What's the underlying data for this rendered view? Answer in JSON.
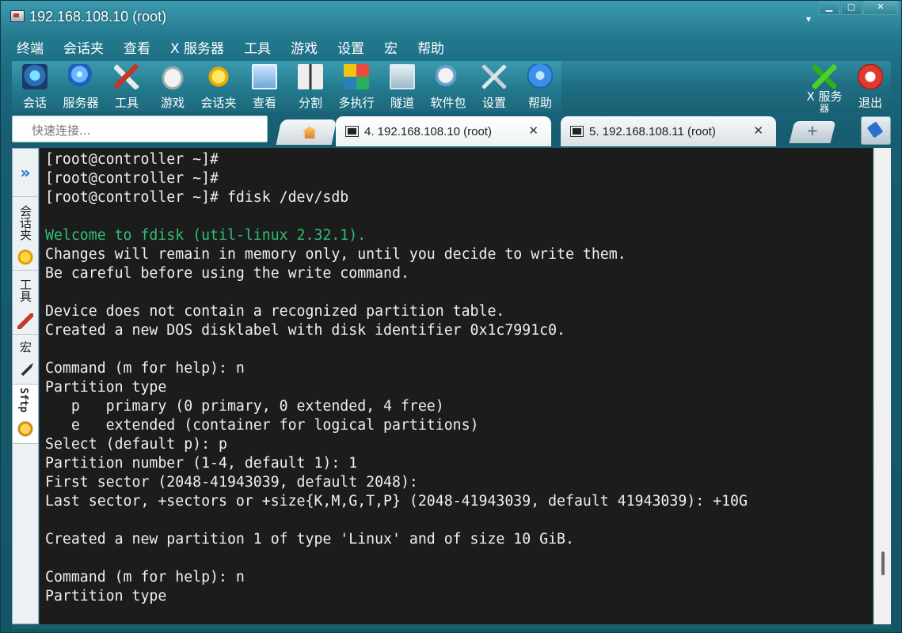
{
  "window": {
    "title": "192.168.108.10 (root)",
    "controls": {
      "tabs_menu": "▾",
      "minimize": "▫",
      "maximize": "▫",
      "close": "✕"
    }
  },
  "menu": [
    "终端",
    "会话夹",
    "查看",
    "X 服务器",
    "工具",
    "游戏",
    "设置",
    "宏",
    "帮助"
  ],
  "toolbar": {
    "items": [
      {
        "label": "会话",
        "icon": "session-icon"
      },
      {
        "label": "服务器",
        "icon": "servers-icon"
      },
      {
        "label": "工具",
        "icon": "tools-icon"
      },
      {
        "label": "游戏",
        "icon": "games-icon"
      },
      {
        "label": "会话夹",
        "icon": "favorites-star-icon"
      },
      {
        "label": "查看",
        "icon": "view-icon"
      },
      {
        "label": "分割",
        "icon": "split-icon"
      },
      {
        "label": "多执行",
        "icon": "multiexec-icon"
      },
      {
        "label": "隧道",
        "icon": "tunnel-icon"
      },
      {
        "label": "软件包",
        "icon": "packages-icon"
      },
      {
        "label": "设置",
        "icon": "settings-icon"
      },
      {
        "label": "帮助",
        "icon": "help-icon"
      }
    ],
    "xserver_label_line1": "X 服务",
    "xserver_label_line2": "器",
    "exit_label": "退出"
  },
  "quick_connect": {
    "placeholder": "快速连接..."
  },
  "tabs": [
    {
      "label": "4. 192.168.108.10 (root)",
      "close": "✕",
      "active": true
    },
    {
      "label": "5. 192.168.108.11 (root)",
      "close": "✕",
      "active": false
    }
  ],
  "add_tab": "+",
  "side_panel": {
    "expand": "»",
    "tabs": [
      {
        "label": "会话夹",
        "icon": "star-icon"
      },
      {
        "label": "工具",
        "icon": "tools-icon"
      },
      {
        "label": "宏",
        "icon": "macro-icon"
      },
      {
        "label": "Sftp",
        "icon": "sftp-icon"
      }
    ]
  },
  "terminal": {
    "lines": [
      {
        "text": "[root@controller ~]#",
        "color": "default"
      },
      {
        "text": "[root@controller ~]#",
        "color": "default"
      },
      {
        "text": "[root@controller ~]# fdisk /dev/sdb",
        "color": "default"
      },
      {
        "text": "",
        "color": "default"
      },
      {
        "text": "Welcome to fdisk (util-linux 2.32.1).",
        "color": "green"
      },
      {
        "text": "Changes will remain in memory only, until you decide to write them.",
        "color": "default"
      },
      {
        "text": "Be careful before using the write command.",
        "color": "default"
      },
      {
        "text": "",
        "color": "default"
      },
      {
        "text": "Device does not contain a recognized partition table.",
        "color": "default"
      },
      {
        "text": "Created a new DOS disklabel with disk identifier 0x1c7991c0.",
        "color": "default"
      },
      {
        "text": "",
        "color": "default"
      },
      {
        "text": "Command (m for help): n",
        "color": "default"
      },
      {
        "text": "Partition type",
        "color": "default"
      },
      {
        "text": "   p   primary (0 primary, 0 extended, 4 free)",
        "color": "default"
      },
      {
        "text": "   e   extended (container for logical partitions)",
        "color": "default"
      },
      {
        "text": "Select (default p): p",
        "color": "default"
      },
      {
        "text": "Partition number (1-4, default 1): 1",
        "color": "default"
      },
      {
        "text": "First sector (2048-41943039, default 2048):",
        "color": "default"
      },
      {
        "text": "Last sector, +sectors or +size{K,M,G,T,P} (2048-41943039, default 41943039): +10G",
        "color": "default"
      },
      {
        "text": "",
        "color": "default"
      },
      {
        "text": "Created a new partition 1 of type 'Linux' and of size 10 GiB.",
        "color": "default"
      },
      {
        "text": "",
        "color": "default"
      },
      {
        "text": "Command (m for help): n",
        "color": "default"
      },
      {
        "text": "Partition type",
        "color": "default"
      }
    ],
    "colors": {
      "background": "#1c1c1c",
      "foreground": "#f0f0f0",
      "green": "#2fbf76"
    }
  }
}
